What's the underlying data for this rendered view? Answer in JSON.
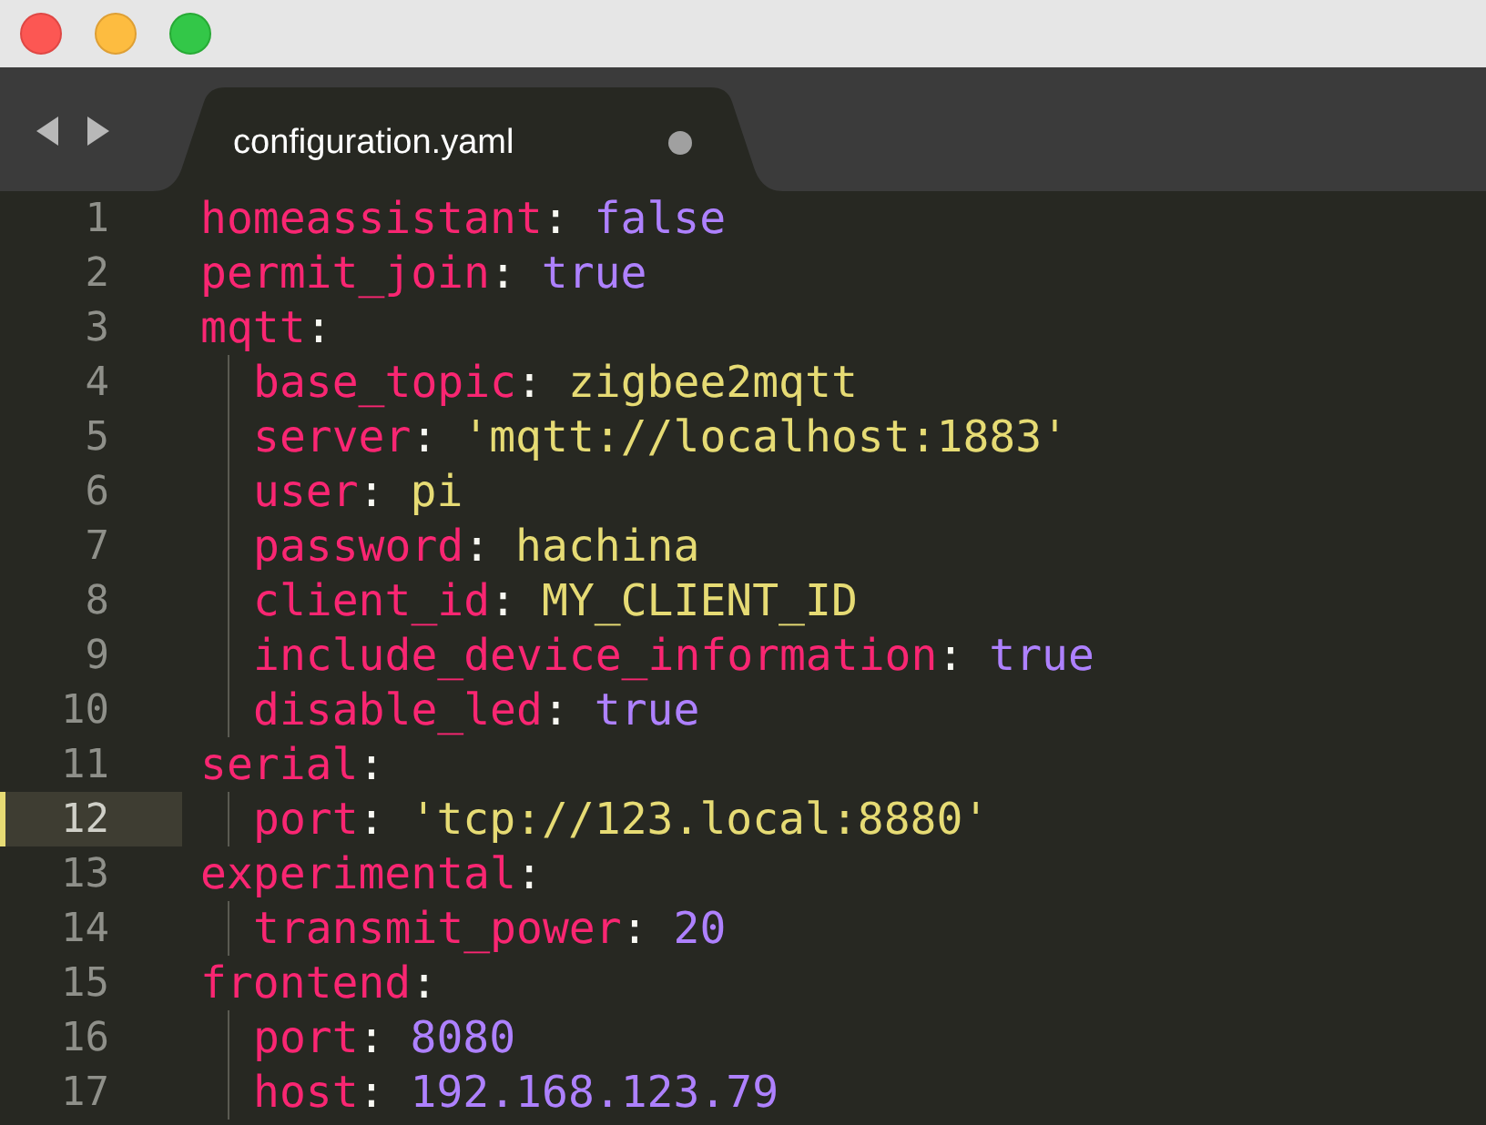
{
  "tab": {
    "label": "configuration.yaml",
    "modified": true
  },
  "lines": [
    {
      "number": "1",
      "key": "homeassistant",
      "colon": ":",
      "value": "false",
      "color": "#ae81ff",
      "selected": false
    },
    {
      "number": "2",
      "key": "permit_join",
      "colon": ":",
      "value": "true",
      "color": "#ae81ff",
      "selected": false
    },
    {
      "number": "3",
      "key": "mqtt",
      "colon": ":",
      "selected": false,
      "children": [
        {
          "number": "4",
          "key": "base_topic",
          "colon": ":",
          "value": "zigbee2mqtt",
          "color": "#e6db74",
          "selected": false
        },
        {
          "number": "5",
          "key": "server",
          "colon": ":",
          "value": "'mqtt://localhost:1883'",
          "color": "#e6db74",
          "selected": false
        },
        {
          "number": "6",
          "key": "user",
          "colon": ":",
          "value": "pi",
          "color": "#e6db74",
          "selected": false
        },
        {
          "number": "7",
          "key": "password",
          "colon": ":",
          "value": "hachina",
          "color": "#e6db74",
          "selected": false
        },
        {
          "number": "8",
          "key": "client_id",
          "colon": ":",
          "value": "MY_CLIENT_ID",
          "color": "#e6db74",
          "selected": false
        },
        {
          "number": "9",
          "key": "include_device_information",
          "colon": ":",
          "value": "true",
          "color": "#ae81ff",
          "selected": false
        },
        {
          "number": "10",
          "key": "disable_led",
          "colon": ":",
          "value": "true",
          "color": "#ae81ff",
          "selected": false
        }
      ]
    },
    {
      "number": "11",
      "key": "serial",
      "colon": ":",
      "selected": false,
      "children": [
        {
          "number": "12",
          "key": "port",
          "colon": ":",
          "value": "'tcp://123.local:8880'",
          "color": "#e6db74",
          "selected": true
        }
      ]
    },
    {
      "number": "13",
      "key": "experimental",
      "colon": ":",
      "selected": false,
      "children": [
        {
          "number": "14",
          "key": "transmit_power",
          "colon": ":",
          "value": "20",
          "color": "#ae81ff",
          "selected": false
        }
      ]
    },
    {
      "number": "15",
      "key": "frontend",
      "colon": ":",
      "selected": false,
      "children": [
        {
          "number": "16",
          "key": "port",
          "colon": ":",
          "value": "8080",
          "color": "#ae81ff",
          "selected": false
        },
        {
          "number": "17",
          "key": "host",
          "colon": ":",
          "value": "192.168.123.79",
          "color": "#ae81ff",
          "selected": false
        }
      ]
    }
  ]
}
